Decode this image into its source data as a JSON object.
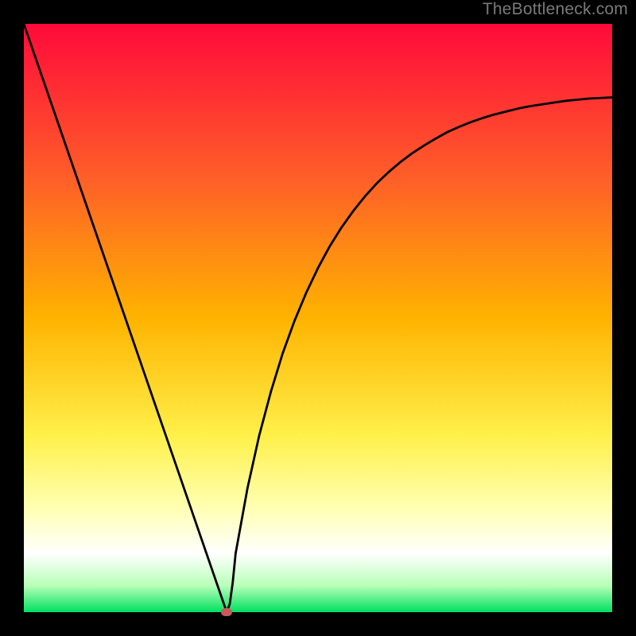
{
  "watermark": "TheBottleneck.com",
  "chart_data": {
    "type": "line",
    "title": "",
    "xlabel": "",
    "ylabel": "",
    "xlim": [
      0,
      1
    ],
    "ylim": [
      0,
      1
    ],
    "x": [
      0.0,
      0.02,
      0.04,
      0.06,
      0.08,
      0.1,
      0.12,
      0.14,
      0.16,
      0.18,
      0.2,
      0.22,
      0.24,
      0.26,
      0.28,
      0.3,
      0.32,
      0.34,
      0.345,
      0.35,
      0.355,
      0.36,
      0.38,
      0.4,
      0.42,
      0.44,
      0.46,
      0.48,
      0.5,
      0.52,
      0.54,
      0.56,
      0.58,
      0.6,
      0.62,
      0.64,
      0.66,
      0.68,
      0.7,
      0.72,
      0.74,
      0.76,
      0.78,
      0.8,
      0.82,
      0.84,
      0.86,
      0.88,
      0.9,
      0.92,
      0.94,
      0.96,
      0.98,
      1.0
    ],
    "values": [
      1.0,
      0.942,
      0.884,
      0.826,
      0.768,
      0.71,
      0.652,
      0.594,
      0.536,
      0.478,
      0.42,
      0.362,
      0.304,
      0.246,
      0.188,
      0.13,
      0.072,
      0.014,
      0.0,
      0.014,
      0.05,
      0.1,
      0.21,
      0.3,
      0.375,
      0.44,
      0.495,
      0.543,
      0.585,
      0.622,
      0.654,
      0.682,
      0.707,
      0.729,
      0.748,
      0.765,
      0.78,
      0.793,
      0.805,
      0.816,
      0.825,
      0.833,
      0.84,
      0.846,
      0.851,
      0.856,
      0.86,
      0.863,
      0.866,
      0.869,
      0.871,
      0.873,
      0.874,
      0.875
    ],
    "marker": {
      "x": 0.345,
      "y": 0.0
    },
    "background": {
      "type": "vertical-gradient",
      "stops": [
        {
          "pos": 0.0,
          "color": "#ff0a3a"
        },
        {
          "pos": 0.25,
          "color": "#ff5a2a"
        },
        {
          "pos": 0.5,
          "color": "#ffb300"
        },
        {
          "pos": 0.7,
          "color": "#fff04a"
        },
        {
          "pos": 0.82,
          "color": "#ffffb0"
        },
        {
          "pos": 0.9,
          "color": "#ffffff"
        },
        {
          "pos": 0.955,
          "color": "#b8ffb8"
        },
        {
          "pos": 1.0,
          "color": "#00e060"
        }
      ]
    }
  }
}
